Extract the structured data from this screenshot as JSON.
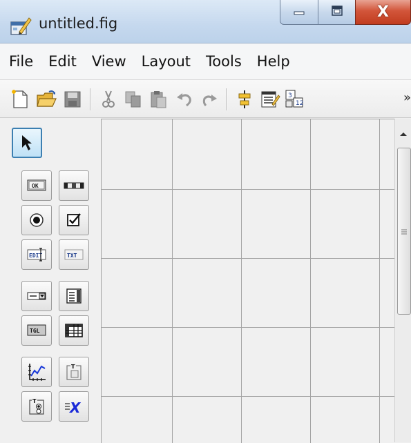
{
  "window": {
    "title": "untitled.fig",
    "close_glyph": "X"
  },
  "menubar": {
    "items": [
      "File",
      "Edit",
      "View",
      "Layout",
      "Tools",
      "Help"
    ]
  },
  "toolbar": {
    "buttons": [
      "new-file-icon",
      "open-folder-icon",
      "save-icon",
      "cut-icon",
      "copy-icon",
      "paste-icon",
      "undo-icon",
      "redo-icon",
      "align-objects-icon",
      "menu-editor-icon",
      "tab-order-editor-icon"
    ],
    "overflow_glyph": "»"
  },
  "palette": {
    "tools": [
      {
        "name": "select-tool",
        "icon": "arrow-pointer-icon",
        "selected": true
      },
      {
        "name": "push-button-tool",
        "icon": "push-button-icon",
        "text": "OK"
      },
      {
        "name": "slider-tool",
        "icon": "slider-icon"
      },
      {
        "name": "radio-button-tool",
        "icon": "radio-button-icon"
      },
      {
        "name": "checkbox-tool",
        "icon": "checkbox-icon"
      },
      {
        "name": "edit-text-tool",
        "icon": "edit-text-icon",
        "text": "EDIT"
      },
      {
        "name": "static-text-tool",
        "icon": "static-text-icon",
        "text": "TXT"
      },
      {
        "name": "popup-menu-tool",
        "icon": "popup-menu-icon"
      },
      {
        "name": "listbox-tool",
        "icon": "listbox-icon"
      },
      {
        "name": "toggle-button-tool",
        "icon": "toggle-button-icon",
        "text": "TGL"
      },
      {
        "name": "table-tool",
        "icon": "table-icon"
      },
      {
        "name": "axes-tool",
        "icon": "axes-icon"
      },
      {
        "name": "panel-tool",
        "icon": "panel-icon",
        "text": "T"
      },
      {
        "name": "button-group-tool",
        "icon": "button-group-icon",
        "text": "T"
      },
      {
        "name": "activex-control-tool",
        "icon": "activex-icon",
        "text": "X"
      }
    ]
  },
  "colors": {
    "title_bar": "#c5d8ee",
    "close_button": "#c9452a",
    "selected_tool": "#bfe1f6",
    "canvas": "#f0f0f0",
    "grid": "#a3a3a3"
  }
}
